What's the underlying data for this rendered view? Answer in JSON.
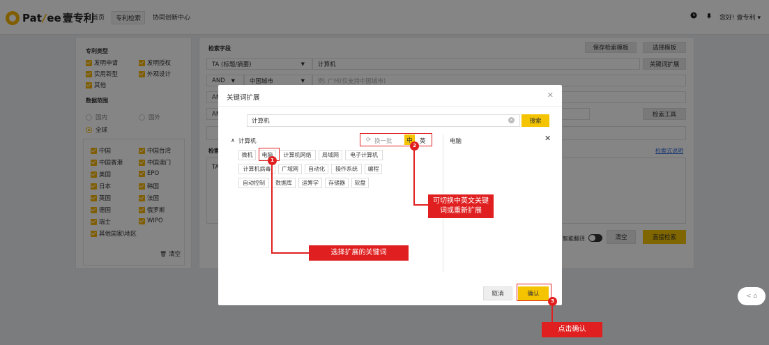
{
  "header": {
    "brand": "Pat",
    "brand2": "ee",
    "brand_cn": "壹专利",
    "nav": [
      "首页",
      "专利检索",
      "协同创新中心"
    ],
    "user": "您好! 壹专利 ▾"
  },
  "left": {
    "patent_type_label": "专利类型",
    "patent_types": [
      "发明申请",
      "发明授权",
      "实用新型",
      "外观设计",
      "其他"
    ],
    "scope_label": "数据范围",
    "scope_options": [
      "国内",
      "国外",
      "全球"
    ],
    "regions": [
      "中国",
      "中国台湾",
      "中国香港",
      "中国澳门",
      "美国",
      "EPO",
      "日本",
      "韩国",
      "英国",
      "法国",
      "德国",
      "俄罗斯",
      "瑞士",
      "WIPO",
      "其他国家\\地区"
    ],
    "clear": "清空"
  },
  "main": {
    "field_label": "检索字段",
    "save_template": "保存检索模板",
    "choose_template": "选择模板",
    "row1_field": "TA (标题/摘要)",
    "row1_value": "计算机",
    "keyword_expand": "关键词扩展",
    "row2_op": "AND",
    "row2_field": "中国城市",
    "row2_placeholder": "例: 广州(仅支持中国城市)",
    "row3_op": "AN",
    "row4_op": "AN",
    "search_tool": "检索工具",
    "expr_label": "检索",
    "expr_help": "检索式说明",
    "expr_prefix": "TA",
    "smart_translate": "智能翻译",
    "clear": "清空",
    "direct_search": "直接检索"
  },
  "modal": {
    "title": "关键词扩展",
    "search_value": "计算机",
    "search_btn": "搜索",
    "group_title": "计算机",
    "refresh": "换一批",
    "lang_cn": "中",
    "lang_en": "英",
    "tags": [
      "微机",
      "电脑",
      "计算机网络",
      "局域网",
      "电子计算机",
      "计算机病毒",
      "广域网",
      "自动化",
      "操作系统",
      "编程",
      "自动控制",
      "数据库",
      "运筹学",
      "存储器",
      "软盘"
    ],
    "selected_title": "电脑",
    "cancel": "取消",
    "confirm": "确认"
  },
  "annotations": {
    "badge1": "1",
    "badge2": "2",
    "badge3": "3",
    "callout1": "选择扩展的关键词",
    "callout2": "可切换中英文关键词或重新扩展",
    "callout3": "点击确认"
  },
  "float": "< ⌂",
  "colors": {
    "accent": "#f5c400",
    "annotation": "#e02020"
  }
}
